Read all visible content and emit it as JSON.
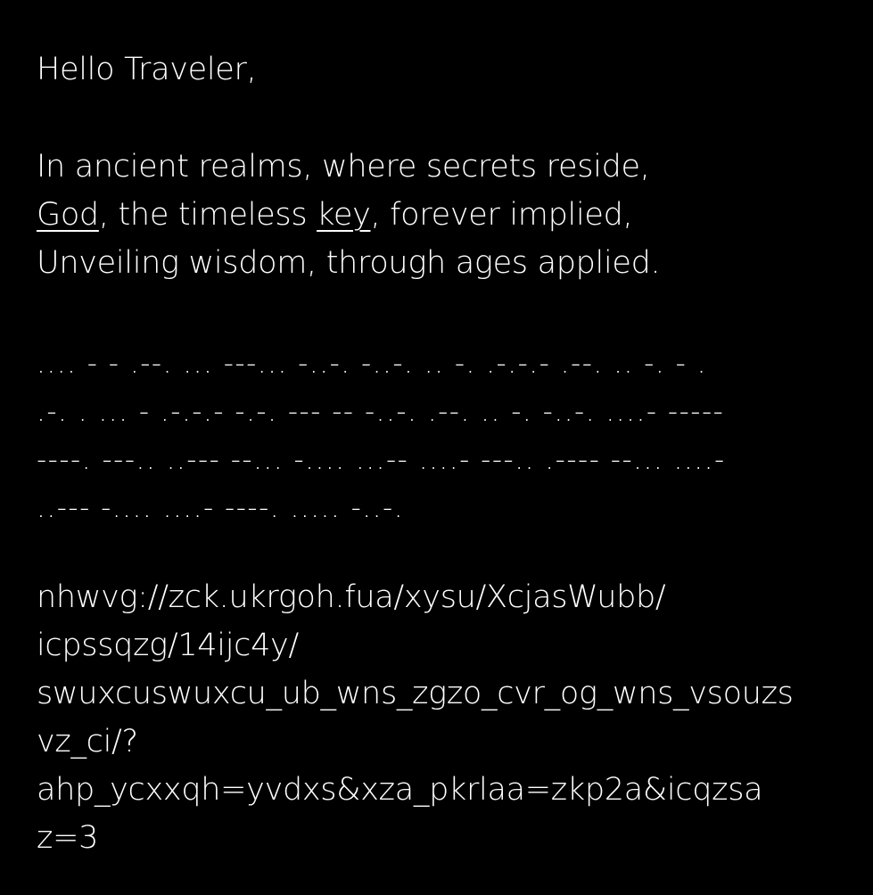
{
  "greeting": "Hello Traveler,",
  "poem": {
    "line1": "In ancient realms, where secrets reside,",
    "line2": {
      "word1": "God",
      "middle": ", the timeless ",
      "word2": "key",
      "end": ", forever implied,"
    },
    "line3": "Unveiling wisdom, through ages applied."
  },
  "morse_lines": [
    ".... - - .--. ... ---... -..-. -..-. .. -. .-.-.- .--. .. -. - .",
    ".-. . ... - .-.-.- -.-. --- -- -..-. .--. .. -. -..-. ....- -----",
    "----. ---.. ..--- --... -.... ...-- ....- ---.. .---- --... ....-",
    "..--- -.... ....- ----. ..... -..-."
  ],
  "url_lines": [
    "nhwvg://zck.ukrgoh.fua/xysu/XcjasWubb/",
    "icpssqzg/14ijc4y/",
    "swuxcuswuxcu_ub_wns_zgzo_cvr_og_wns_vsouzs",
    "vz_ci/?",
    "ahp_ycxxqh=yvdxs&xza_pkrlaa=zkp2a&icqzsa",
    "z=3"
  ]
}
